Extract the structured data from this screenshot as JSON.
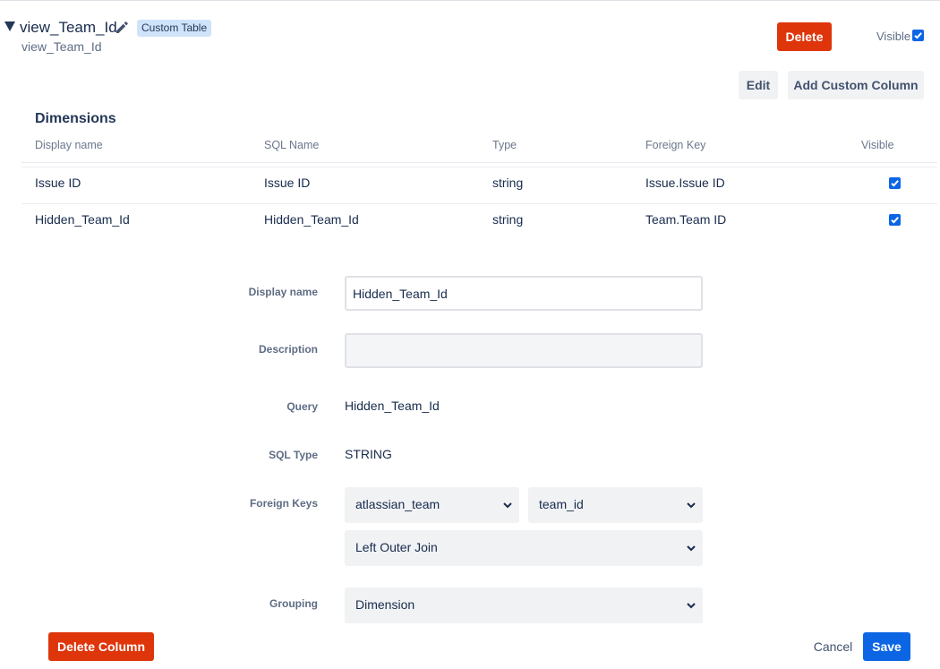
{
  "header": {
    "title": "view_Team_Id",
    "badge": "Custom Table",
    "subtitle": "view_Team_Id",
    "delete_label": "Delete",
    "visible_label": "Visible",
    "visible_checked": true,
    "edit_label": "Edit",
    "add_column_label": "Add Custom Column"
  },
  "dimensions": {
    "title": "Dimensions",
    "columns": [
      "Display name",
      "SQL Name",
      "Type",
      "Foreign Key",
      "Visible"
    ],
    "rows": [
      {
        "display_name": "Issue ID",
        "sql_name": "Issue ID",
        "type": "string",
        "foreign_key": "Issue.Issue ID",
        "visible": true
      },
      {
        "display_name": "Hidden_Team_Id",
        "sql_name": "Hidden_Team_Id",
        "type": "string",
        "foreign_key": "Team.Team ID",
        "visible": true
      }
    ]
  },
  "form": {
    "display_name_label": "Display name",
    "display_name_value": "Hidden_Team_Id",
    "description_label": "Description",
    "description_value": "",
    "query_label": "Query",
    "query_value": "Hidden_Team_Id",
    "sql_type_label": "SQL Type",
    "sql_type_value": "STRING",
    "foreign_keys_label": "Foreign Keys",
    "fk_table": "atlassian_team",
    "fk_column": "team_id",
    "fk_join": "Left Outer Join",
    "grouping_label": "Grouping",
    "grouping_value": "Dimension"
  },
  "footer": {
    "delete_column_label": "Delete Column",
    "cancel_label": "Cancel",
    "save_label": "Save"
  },
  "colors": {
    "danger": "#de350b",
    "primary": "#0c66e4",
    "badge_bg": "#cfe3fb"
  }
}
